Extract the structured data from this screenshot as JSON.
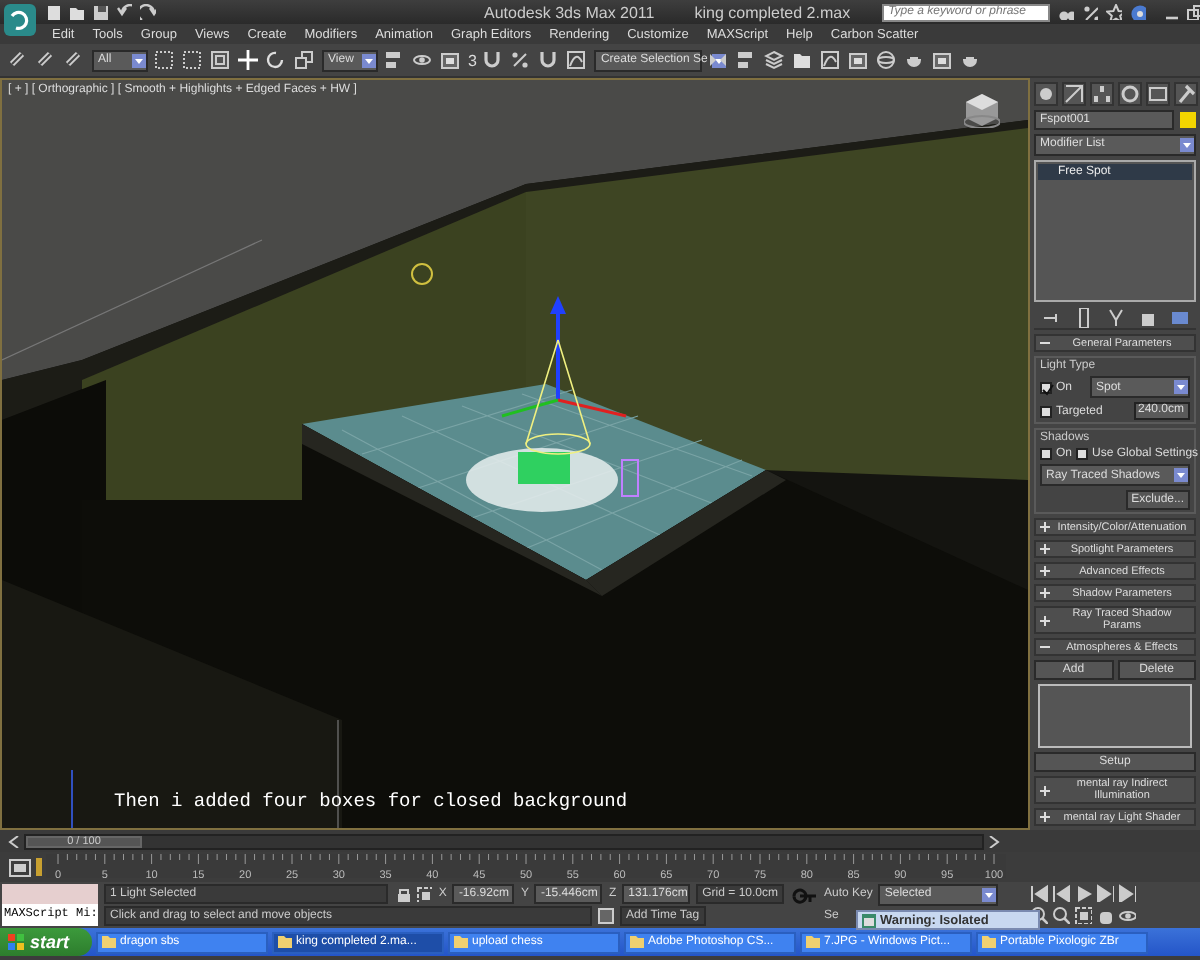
{
  "title_bar": {
    "title": "Autodesk 3ds Max  2011",
    "file": "king completed   2.max",
    "search": {
      "placeholder": "Type a keyword or phrase"
    }
  },
  "menu": [
    "Edit",
    "Tools",
    "Group",
    "Views",
    "Create",
    "Modifiers",
    "Animation",
    "Graph Editors",
    "Rendering",
    "Customize",
    "MAXScript",
    "Help",
    "Carbon Scatter"
  ],
  "toolbar": {
    "filter": "All",
    "ref_coord": "View",
    "snap_count": "3",
    "selection_set": "Create Selection Se"
  },
  "viewport": {
    "label": "[ + ] [ Orthographic ] [ Smooth + Highlights + Edged Faces + HW ]",
    "caption": "Then i added four boxes for closed background"
  },
  "command_panel": {
    "object": {
      "name": "Fspot001",
      "color": "#f2d400"
    },
    "modifier_list": "Modifier List",
    "stack": [
      {
        "label": "Free Spot",
        "selected": true
      }
    ],
    "general": {
      "title": "General Parameters",
      "light_type": "Light Type",
      "on": {
        "label": "On",
        "checked": true
      },
      "type": "Spot",
      "targeted": {
        "label": "Targeted",
        "checked": false
      },
      "distance": "240.0cm",
      "shadows": "Shadows",
      "shadow_on": {
        "label": "On",
        "checked": false
      },
      "global": {
        "label": "Use Global Settings",
        "checked": false
      },
      "shadow_type": "Ray Traced Shadows",
      "exclude": "Exclude..."
    },
    "rollouts": [
      {
        "label": "Intensity/Color/Attenuation",
        "expanded": false
      },
      {
        "label": "Spotlight Parameters",
        "expanded": false
      },
      {
        "label": "Advanced Effects",
        "expanded": false
      },
      {
        "label": "Shadow Parameters",
        "expanded": false
      },
      {
        "label": "Ray Traced Shadow Params",
        "expanded": false
      },
      {
        "label": "Atmospheres & Effects",
        "expanded": true
      }
    ],
    "atmos_buttons": [
      "Add",
      "Delete"
    ],
    "setup": "Setup",
    "extra_rollouts": [
      {
        "label": "mental ray Indirect Illumination",
        "expanded": false
      },
      {
        "label": "mental ray Light Shader",
        "expanded": false
      }
    ]
  },
  "time_slider": {
    "label": "0 / 100",
    "level": 0
  },
  "track_ticks": [
    "0",
    "5",
    "10",
    "15",
    "20",
    "25",
    "30",
    "35",
    "40",
    "45",
    "50",
    "55",
    "60",
    "65",
    "70",
    "75",
    "80",
    "85",
    "90",
    "95",
    "100"
  ],
  "status": {
    "listener": "MAXScript Mi:",
    "selection": "1 Light Selected",
    "prompt": "Click and drag to select and move objects",
    "coords": [
      {
        "label": "X",
        "value": "-16.92cm"
      },
      {
        "label": "Y",
        "value": "-15.446cm"
      },
      {
        "label": "Z",
        "value": "131.176cm"
      }
    ],
    "grid": "Grid = 10.0cm",
    "time_tag": "Add Time Tag",
    "auto_key": "Auto Key",
    "key_filter": "Selected",
    "set_key": "Se"
  },
  "warning": "Warning: Isolated",
  "taskbar": {
    "start": "start",
    "items": [
      {
        "label": "dragon sbs",
        "selected": false
      },
      {
        "label": "king completed   2.ma...",
        "selected": true
      },
      {
        "label": "upload chess",
        "selected": false
      },
      {
        "label": "Adobe Photoshop CS...",
        "selected": false
      },
      {
        "label": "7.JPG - Windows Pict...",
        "selected": false
      },
      {
        "label": "Portable Pixologic ZBr",
        "selected": false
      }
    ]
  }
}
